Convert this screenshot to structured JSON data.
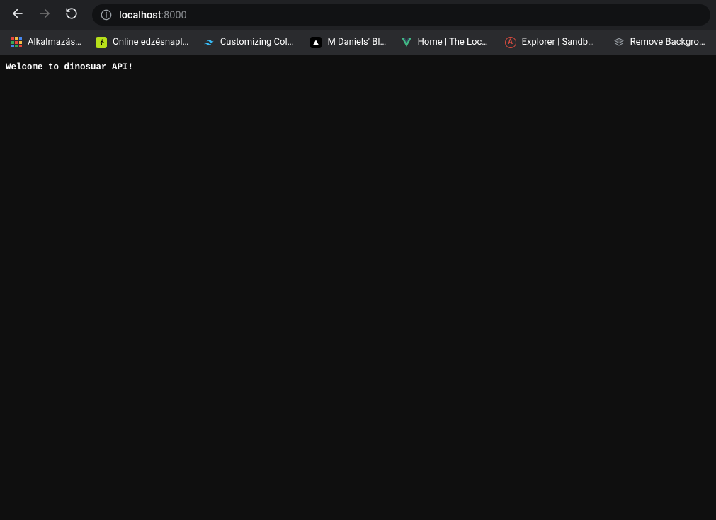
{
  "toolbar": {
    "url_host": "localhost",
    "url_port": ":8000"
  },
  "bookmarks": {
    "items": [
      {
        "label": "Alkalmazások"
      },
      {
        "label": "Online edzésnapló…"
      },
      {
        "label": "Customizing Color…"
      },
      {
        "label": "M Daniels' Blog"
      },
      {
        "label": "Home | The Local…"
      },
      {
        "label": "Explorer | Sandbox…"
      },
      {
        "label": "Remove Backgrou…"
      }
    ]
  },
  "page": {
    "body_text": "Welcome to dinosuar API!"
  }
}
